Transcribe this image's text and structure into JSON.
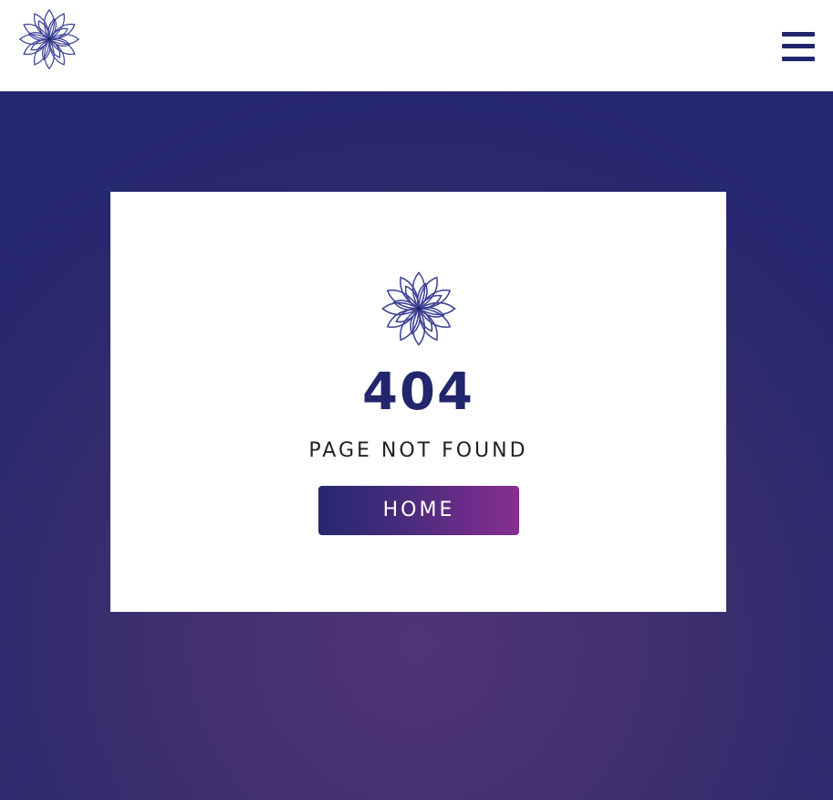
{
  "header": {
    "logo_icon": "lotus-flower-icon",
    "menu_icon": "hamburger-menu-icon"
  },
  "card": {
    "logo_icon": "lotus-flower-icon",
    "error_code": "404",
    "message": "PAGE NOT FOUND",
    "home_label": "HOME"
  },
  "colors": {
    "brand": "#22266c",
    "button_gradient_start": "#25286f",
    "button_gradient_end": "#872e92",
    "background_dark": "#252770",
    "background_light": "#503477"
  }
}
